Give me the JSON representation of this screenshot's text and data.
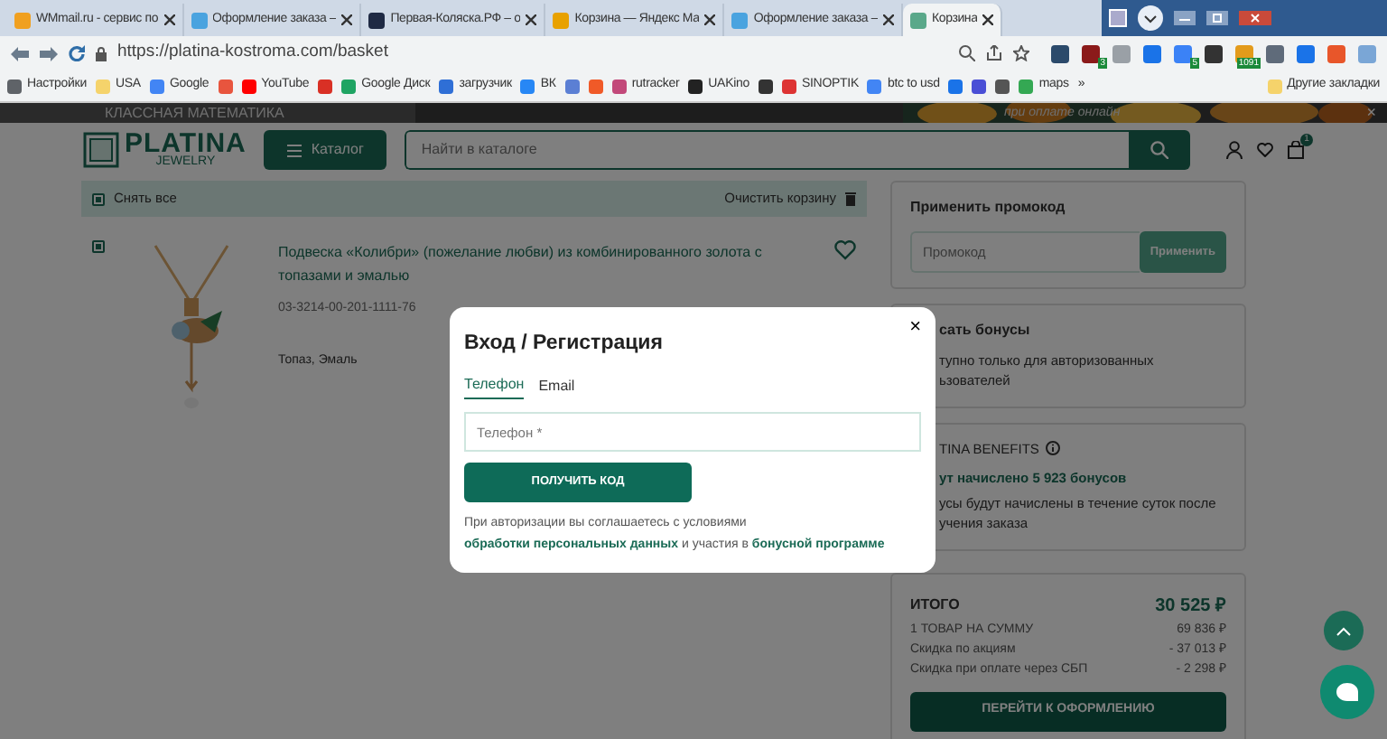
{
  "browser": {
    "tabs": [
      {
        "title": "WMmail.ru - сервис по",
        "color": "#f0a020",
        "selected": false
      },
      {
        "title": "Оформление заказа –",
        "color": "#4aa3df",
        "selected": false
      },
      {
        "title": "Первая-Коляска.РФ – о",
        "color": "#1f2a44",
        "selected": false
      },
      {
        "title": "Корзина — Яндекс Ма",
        "color": "#e8a100",
        "selected": false
      },
      {
        "title": "Оформление заказа –",
        "color": "#4aa3df",
        "selected": false
      },
      {
        "title": "Корзина",
        "color": "#5aa88a",
        "selected": true
      }
    ],
    "url": "https://platina-kostroma.com/basket",
    "extensions": [
      {
        "color": "#2b4a6b"
      },
      {
        "color": "#8b1a1a",
        "badge": "3"
      },
      {
        "color": "#9aa0a6"
      },
      {
        "color": "#1a73e8"
      },
      {
        "color": "#3b82f6",
        "badge": "5"
      },
      {
        "color": "#333333"
      },
      {
        "color": "#e39b1b",
        "badge": "1091"
      },
      {
        "color": "#5f6b7a"
      },
      {
        "color": "#1a73e8"
      },
      {
        "color": "#e8562a"
      },
      {
        "color": "#7aa6d6"
      }
    ],
    "bookmarks": [
      {
        "label": "Настройки",
        "color": "#5f6368"
      },
      {
        "label": "USA",
        "color": "#f5d36b"
      },
      {
        "label": "Google",
        "color": "#4285f4"
      },
      {
        "color": "#e8553e"
      },
      {
        "label": "YouTube",
        "color": "#ff0000"
      },
      {
        "color": "#d93025"
      },
      {
        "label": "Google Диск",
        "color": "#1fa463"
      },
      {
        "label": "загрузчик",
        "color": "#2f6fd6"
      },
      {
        "label": "ВК",
        "color": "#2787f5"
      },
      {
        "color": "#5b7fd4"
      },
      {
        "color": "#f05a28"
      },
      {
        "label": "rutracker",
        "color": "#c2497a"
      },
      {
        "label": "UAKino",
        "color": "#222222"
      },
      {
        "color": "#333333"
      },
      {
        "label": "SINOPTIK",
        "color": "#d33"
      },
      {
        "label": "btc to usd",
        "color": "#4285f4"
      },
      {
        "color": "#1a73e8"
      },
      {
        "color": "#4a4fd6"
      },
      {
        "color": "#555555"
      },
      {
        "label": "maps",
        "color": "#34a853"
      }
    ],
    "more": "»",
    "other_bookmarks": "Другие закладки"
  },
  "banner": {
    "text": "КЛАССНАЯ МАТЕМАТИКА",
    "slogan": "при оплате онлайн",
    "close": "×"
  },
  "header": {
    "logo": "PLATINA",
    "logo_sub": "JEWELRY",
    "catalog": "Каталог",
    "search_placeholder": "Найти в каталоге",
    "cart_count": "1"
  },
  "cart": {
    "select_all": {
      "label": "Снять все",
      "checked": true
    },
    "clear": "Очистить корзину",
    "items": [
      {
        "checked": true,
        "title": "Подвеска «Колибри» (пожелание любви) из комбинированного золота с топазами и эмалью",
        "sku": "03-3214-00-201-1111-76",
        "inserts": "Топаз, Эмаль"
      }
    ]
  },
  "promo": {
    "title": "Применить промокод",
    "placeholder": "Промокод",
    "button": "Применить"
  },
  "bonus": {
    "title": "сать бонусы",
    "lines": [
      "тупно только для авторизованных",
      "ьзователей"
    ]
  },
  "benefits": {
    "title": "TINA BENEFITS",
    "accrued": "ут начислено 5 923 бонусов",
    "lines": [
      "усы будут начислены в течение суток после",
      "учения заказа"
    ]
  },
  "summary": {
    "total_label": "ИТОГО",
    "total": "30 525 ₽",
    "rows": [
      {
        "label": "1 ТОВАР НА СУММУ",
        "value": "69 836 ₽"
      },
      {
        "label": "Скидка по акциям",
        "value": "- 37 013 ₽"
      },
      {
        "label": "Скидка при оплате через СБП",
        "value": "- 2 298 ₽"
      }
    ],
    "checkout": "ПЕРЕЙТИ К ОФОРМЛЕНИЮ"
  },
  "modal": {
    "title": "Вход / Регистрация",
    "close": "×",
    "tabs": [
      {
        "label": "Телефон",
        "selected": true
      },
      {
        "label": "Email",
        "selected": false
      }
    ],
    "placeholder": "Телефон *",
    "button": "ПОЛУЧИТЬ КОД",
    "consent": [
      {
        "kind": "text",
        "text": "При авторизации вы соглашаетесь с условиями"
      },
      {
        "kind": "link",
        "text": "обработки персональных данных"
      },
      {
        "kind": "text",
        "text": "и участия в"
      },
      {
        "kind": "link",
        "text": "бонусной программе"
      }
    ]
  }
}
